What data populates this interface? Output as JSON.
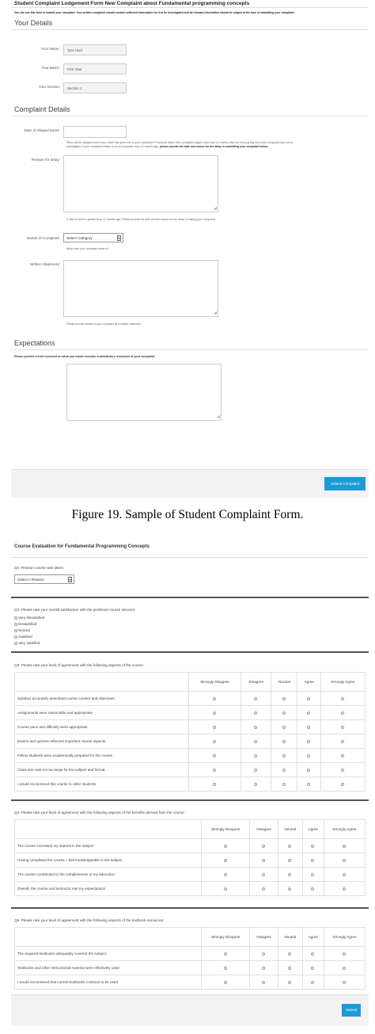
{
  "complaint_form": {
    "title": "Student Complaint Lodgement Form New Complaint about Fundamental programming concepts",
    "intro": "You can use this form to submit your complaint. Your written complaint should contain sufficient information for it to be investigated and all relevant information should be lodged at the time of submitting your complaint.",
    "your_details": {
      "heading": "Your Details",
      "name_label": "Your Name:",
      "name_value": "Tyra Huel",
      "batch_label": "Your Batch:",
      "batch_value": "First Year",
      "section_label": "Your Section:",
      "section_value": "Section 1"
    },
    "complaint_details": {
      "heading": "Complaint Details",
      "date_label": "Date of Alleged Event:",
      "date_help_1": "When did the alleged event occur which has given rise to your complaint? Procedure states that complaints lodged more than 12 months after the event giving rise to the complaint may not be",
      "date_help_2a": "investigated. If your complaint relates to an event greater than 12 months ago, ",
      "date_help_2b": "please provide the date and reason for the delay in submitting your complaint below:",
      "reason_label": "Reason for delay:",
      "reason_help": "If date of event is greater than 12 months ago: Please provide the date and the reason for the delay in making your complaint.",
      "nature_label": "Nature of Complaint:",
      "nature_value": "Select Category",
      "nature_help": "What does your complaint relate to?",
      "statement_label": "Written Statement:",
      "statement_help": "Please provide details of your complaint as a written statement"
    },
    "expectations": {
      "heading": "Expectations",
      "prompt": "Please provide a brief comment on what you would consider a satisfactory resolution of your complaint."
    },
    "submit_label": "Submit Complaint"
  },
  "caption1": "Figure 19. Sample of Student Complaint Form.",
  "evaluation_form": {
    "title": "Course Evaluation for Fundamental Programming Concepts",
    "q1": {
      "label": "Q1- Reason course was taken:",
      "select_value": "Select A Reason"
    },
    "q2": {
      "label": "Q2- Please rate your overall satisfaction with the professor-course intructor:",
      "options": [
        "Very dissatisfied",
        "Dissatisfied",
        "Neutral",
        "Satisfied",
        "Very satisfied"
      ]
    },
    "q3": {
      "label": "Q3- Please rate your level of agreement with the following aspects of the course:",
      "columns": [
        "Strongly Disagree",
        "Disagree",
        "Neutral",
        "Agree",
        "Strongly Agree"
      ],
      "rows": [
        "Syllabus accurately described course content and objectives",
        "Assignments were reasonable and appropriate",
        "Course pace and difficulty were appropriate",
        "Exams and quizzes reflected important course aspects",
        "Fellow students were academically prepared for the course",
        "Class size was not too large for the subject and format",
        "I would recommend this course to other students"
      ]
    },
    "q4": {
      "label": "Q4- Please rate your level of agreement with the following aspects of the benefits derived from the course:",
      "columns": [
        "Strongly Disagree",
        "Disagree",
        "Neutral",
        "Agree",
        "Strongly Agree"
      ],
      "rows": [
        "The course increased my interest in the subject",
        "Having completed the course, I feel knowledgeable in the subject",
        "The course contributed to the completeness of my education",
        "Overall, the course and instructor met my expectations"
      ]
    },
    "q5": {
      "label": "Q5- Please rate your level of agreement with the following aspects of the textbook-resources:",
      "columns": [
        "Strongly Disagree",
        "Disagree",
        "Neutral",
        "Agree",
        "Strongly Agree"
      ],
      "rows": [
        "The required textbooks adequately covered the subject",
        "Textbooks and other instructional material were effectively used",
        "I would recommend that current textbooks continue to be used"
      ]
    },
    "submit_label": "Submit"
  },
  "colors": {
    "accent": "#1e9ad6",
    "footer_bg": "#f2f2f2"
  }
}
